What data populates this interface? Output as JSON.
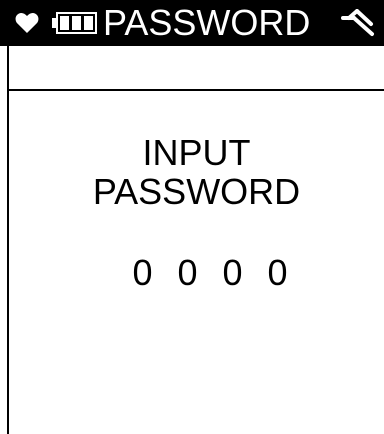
{
  "status_bar": {
    "icons": {
      "left_1": "heart-icon",
      "left_2": "battery-icon",
      "right": "signal-icon"
    },
    "title": "PASSWORD"
  },
  "main": {
    "prompt": {
      "line_1": "INPUT",
      "line_2": "PASSWORD"
    },
    "password_digits": [
      "0",
      "0",
      "0",
      "0"
    ]
  },
  "colors": {
    "background": "#ffffff",
    "foreground": "#000000",
    "status_bar_background": "#000000",
    "status_bar_foreground": "#ffffff"
  }
}
